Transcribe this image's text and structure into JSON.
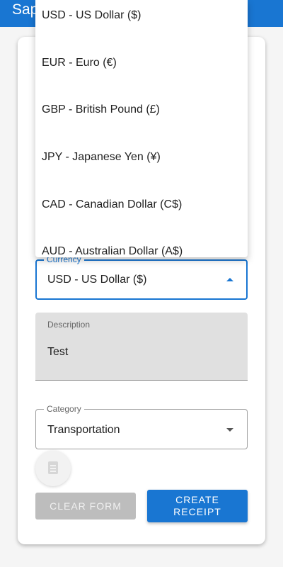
{
  "app_bar": {
    "title": "Sap"
  },
  "currency": {
    "label": "Currency",
    "value": "USD - US Dollar ($)",
    "options": [
      "USD - US Dollar ($)",
      "EUR - Euro (€)",
      "GBP - British Pound (£)",
      "JPY - Japanese Yen (¥)",
      "CAD - Canadian Dollar (C$)",
      "AUD - Australian Dollar (A$)"
    ]
  },
  "description": {
    "label": "Description",
    "value": "Test"
  },
  "category": {
    "label": "Category",
    "value": "Transportation"
  },
  "receipt_button": {
    "icon": "receipt-icon"
  },
  "buttons": {
    "clear_label": "Clear Form",
    "create_label": "Create Receipt"
  },
  "colors": {
    "primary": "#1976d2",
    "disabled": "#bdbdbd"
  }
}
